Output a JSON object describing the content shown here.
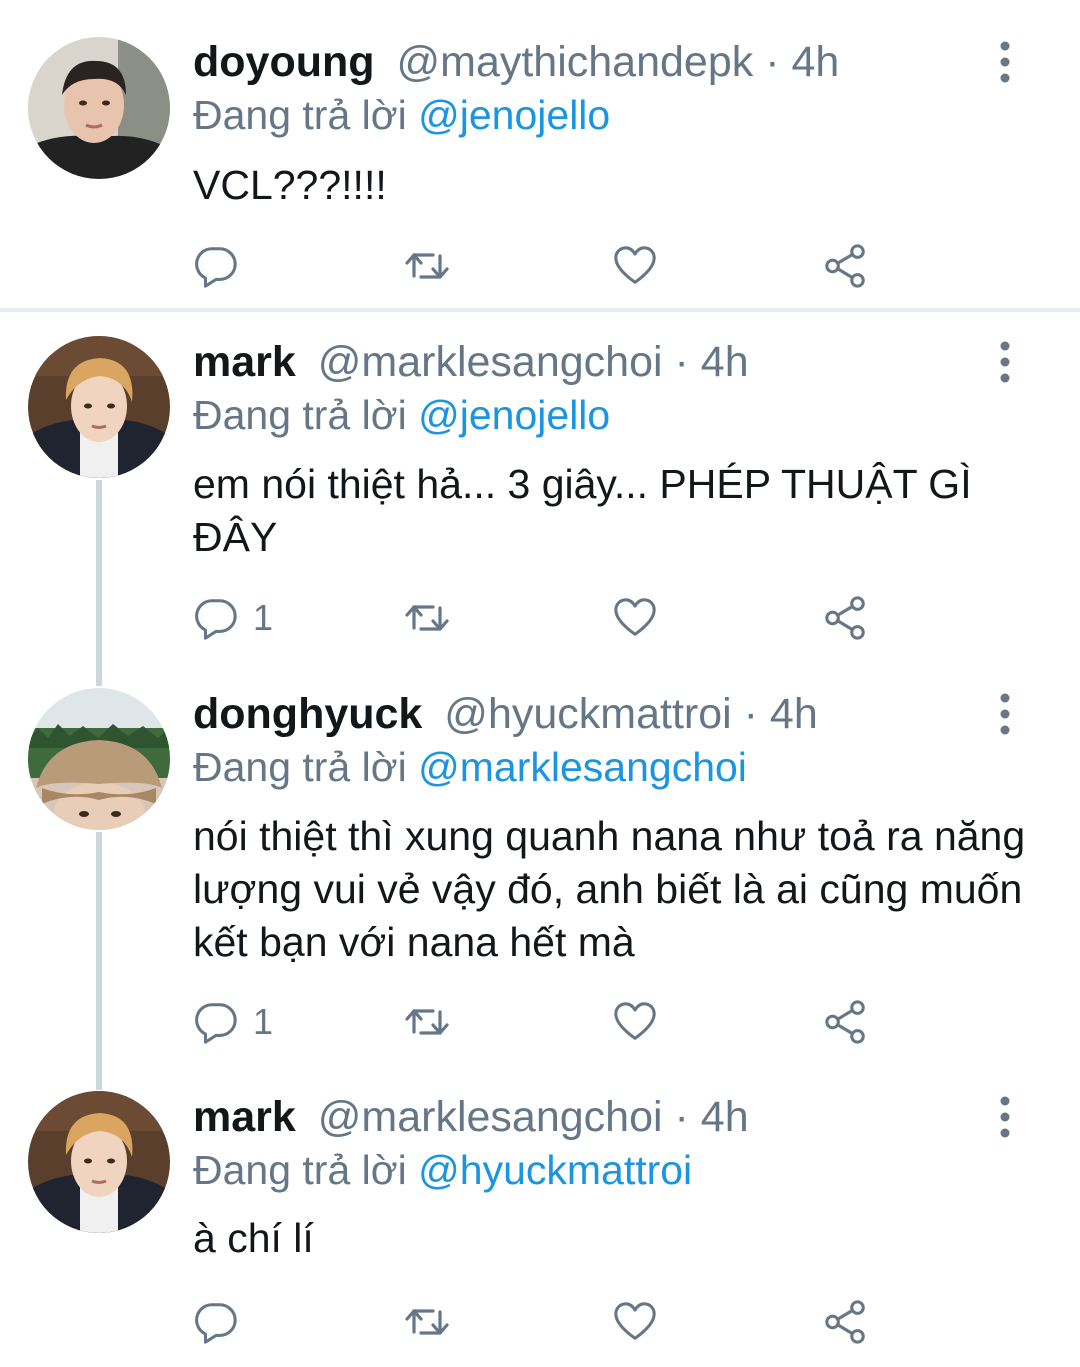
{
  "tweets": [
    {
      "name": "doyoung",
      "handle": "@maythichandepk",
      "sep": " · ",
      "time": "4h",
      "reply_prefix": "Đang trả lời ",
      "reply_to": "@jenojello",
      "text": "VCL???!!!!",
      "reply_count": ""
    },
    {
      "name": "mark",
      "handle": "@marklesangchoi",
      "sep": " · ",
      "time": "4h",
      "reply_prefix": "Đang trả lời ",
      "reply_to": "@jenojello",
      "text": "em nói thiệt hả... 3 giây... PHÉP THUẬT GÌ ĐÂY",
      "reply_count": "1"
    },
    {
      "name": "donghyuck",
      "handle": "@hyuckmattroi",
      "sep": " · ",
      "time": "4h",
      "reply_prefix": "Đang trả lời ",
      "reply_to": "@marklesangchoi",
      "text": "nói thiệt thì xung quanh nana như toả ra năng lượng vui vẻ vậy đó, anh biết là ai cũng muốn kết bạn với nana hết mà",
      "reply_count": "1"
    },
    {
      "name": "mark",
      "handle": "@marklesangchoi",
      "sep": " · ",
      "time": "4h",
      "reply_prefix": "Đang trả lời ",
      "reply_to": "@hyuckmattroi",
      "text": "à chí lí",
      "reply_count": ""
    }
  ],
  "icons": {
    "reply": "reply-icon",
    "retweet": "retweet-icon",
    "like": "heart-icon",
    "share": "share-icon",
    "more": "more-vertical-icon"
  },
  "colors": {
    "text": "#14171a",
    "muted": "#657786",
    "link": "#1b95e0",
    "thread_line": "#ccd6dd",
    "divider": "#e6ecf0"
  }
}
